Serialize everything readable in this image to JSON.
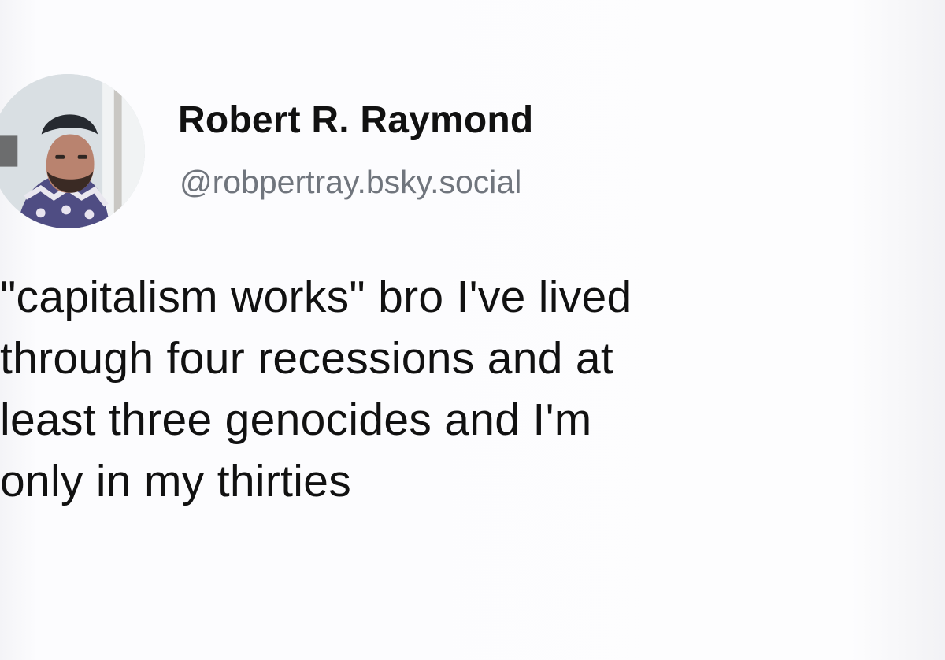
{
  "post": {
    "author": {
      "display_name": "Robert R. Raymond",
      "handle": "@robpertray.bsky.social",
      "avatar_icon": "profile-photo"
    },
    "text": "\"capitalism works\" bro I've lived\nthrough four recessions and at\nleast three genocides and I'm\nonly in my thirties"
  }
}
